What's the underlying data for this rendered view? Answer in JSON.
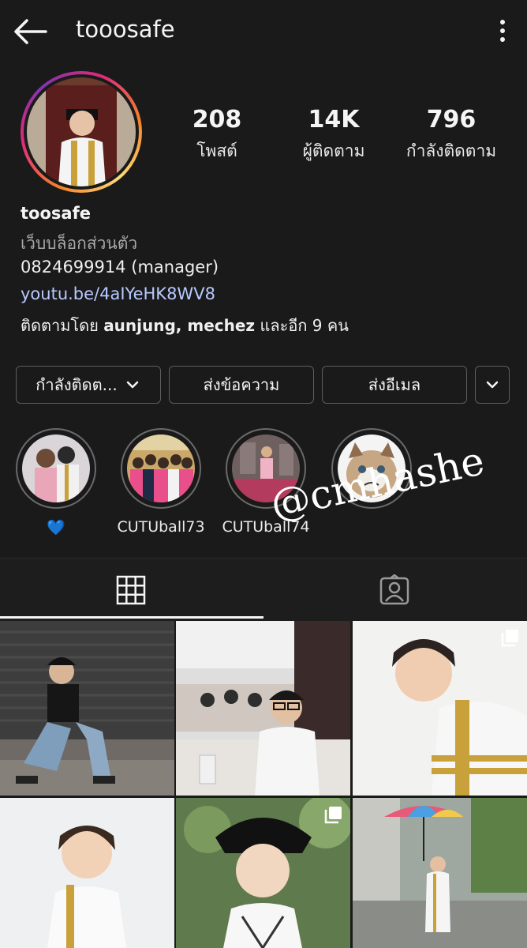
{
  "header": {
    "username": "tooosafe",
    "back_icon": "arrow-left-icon",
    "menu_icon": "more-vertical-icon"
  },
  "stats": [
    {
      "value": "208",
      "label": "โพสต์"
    },
    {
      "value": "14K",
      "label": "ผู้ติดตาม"
    },
    {
      "value": "796",
      "label": "กำลังติดตาม"
    }
  ],
  "bio": {
    "name": "toosafe",
    "category": "เว็บบล็อกส่วนตัว",
    "phone": "0824699914  (manager)",
    "link": "youtu.be/4aIYeHK8WV8",
    "followed_prefix": "ติดตามโดย",
    "followed_names": "aunjung, mechez",
    "followed_suffix": "และอีก 9 คน"
  },
  "actions": {
    "following": "กำลังติดต...",
    "message": "ส่งข้อความ",
    "email": "ส่งอีเมล"
  },
  "highlights": [
    {
      "label": "💙"
    },
    {
      "label": "CUTUball73"
    },
    {
      "label": "CUTUball74"
    },
    {
      "label": ""
    }
  ],
  "watermark": "@cmhashe",
  "tabs": {
    "active": "grid"
  },
  "colors": {
    "background": "#1a1a1a",
    "link": "#b7c9ff",
    "story_ring": "#dd2a7b"
  }
}
